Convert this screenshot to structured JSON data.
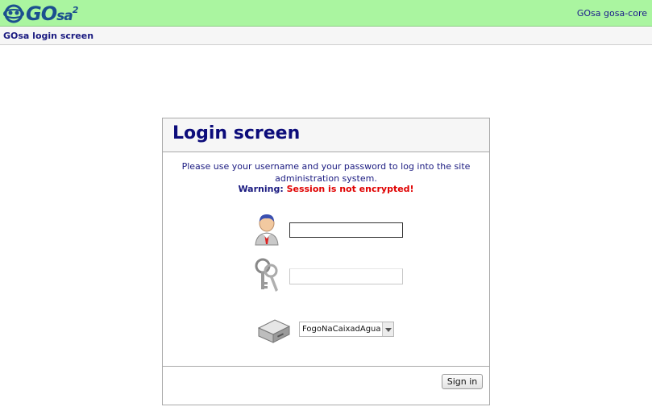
{
  "app": {
    "logo_main": "GO",
    "logo_sa": "sa",
    "logo_sup": "2",
    "server_label": "GOsa gosa-core"
  },
  "subheader": {
    "title": "GOsa login screen"
  },
  "login": {
    "heading": "Login screen",
    "message": "Please use your username and your password to log into the site administration system.",
    "warning_label": "Warning:",
    "warning_text": "Session is not encrypted!",
    "username_value": "",
    "password_value": "",
    "server_selected": "FogoNaCaixadAgua",
    "signin_label": "Sign in"
  },
  "icons": {
    "logo": "gosa-logo-icon",
    "user": "user-icon",
    "password": "keys-icon",
    "server": "server-icon",
    "dropdown": "chevron-down-icon"
  },
  "colors": {
    "topbar": "#aaf5a0",
    "heading": "#0c0c7a",
    "warning": "#e00000"
  }
}
